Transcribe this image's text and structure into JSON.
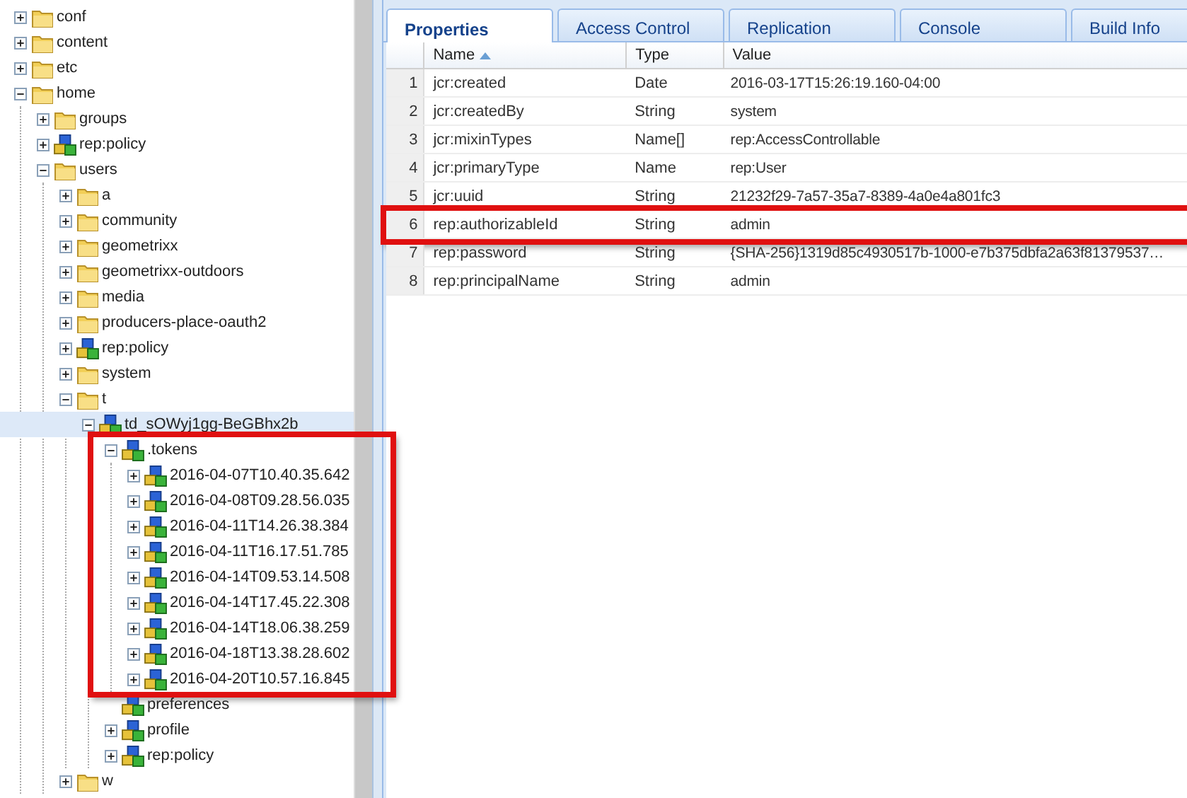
{
  "tree": [
    {
      "label": "conf",
      "kind": "folder",
      "expanded": false,
      "expandable": true,
      "selected": false,
      "highlighted": false
    },
    {
      "label": "content",
      "kind": "folder",
      "expanded": false,
      "expandable": true,
      "selected": false,
      "highlighted": false
    },
    {
      "label": "etc",
      "kind": "folder",
      "expanded": false,
      "expandable": true,
      "selected": false,
      "highlighted": false
    },
    {
      "label": "home",
      "kind": "folder",
      "expanded": true,
      "expandable": true,
      "selected": false,
      "highlighted": false,
      "children": [
        {
          "label": "groups",
          "kind": "folder",
          "expanded": false,
          "expandable": true,
          "selected": false,
          "highlighted": false
        },
        {
          "label": "rep:policy",
          "kind": "node",
          "expanded": false,
          "expandable": true,
          "selected": false,
          "highlighted": false
        },
        {
          "label": "users",
          "kind": "folder",
          "expanded": true,
          "expandable": true,
          "selected": false,
          "highlighted": false,
          "children": [
            {
              "label": "a",
              "kind": "folder",
              "expanded": false,
              "expandable": true,
              "selected": false,
              "highlighted": false
            },
            {
              "label": "community",
              "kind": "folder",
              "expanded": false,
              "expandable": true,
              "selected": false,
              "highlighted": false
            },
            {
              "label": "geometrixx",
              "kind": "folder",
              "expanded": false,
              "expandable": true,
              "selected": false,
              "highlighted": false
            },
            {
              "label": "geometrixx-outdoors",
              "kind": "folder",
              "expanded": false,
              "expandable": true,
              "selected": false,
              "highlighted": false
            },
            {
              "label": "media",
              "kind": "folder",
              "expanded": false,
              "expandable": true,
              "selected": false,
              "highlighted": false
            },
            {
              "label": "producers-place-oauth2",
              "kind": "folder",
              "expanded": false,
              "expandable": true,
              "selected": false,
              "highlighted": false
            },
            {
              "label": "rep:policy",
              "kind": "node",
              "expanded": false,
              "expandable": true,
              "selected": false,
              "highlighted": false
            },
            {
              "label": "system",
              "kind": "folder",
              "expanded": false,
              "expandable": true,
              "selected": false,
              "highlighted": false
            },
            {
              "label": "t",
              "kind": "folder",
              "expanded": true,
              "expandable": true,
              "selected": false,
              "highlighted": false,
              "children": [
                {
                  "label": "td_sOWyj1gg-BeGBhx2b",
                  "kind": "node",
                  "expanded": true,
                  "expandable": true,
                  "selected": true,
                  "highlighted": false,
                  "children": [
                    {
                      "label": ".tokens",
                      "kind": "node",
                      "expanded": true,
                      "expandable": true,
                      "selected": false,
                      "highlighted": true,
                      "children": [
                        {
                          "label": "2016-04-07T10.40.35.642",
                          "kind": "node",
                          "expanded": false,
                          "expandable": true,
                          "selected": false,
                          "highlighted": false
                        },
                        {
                          "label": "2016-04-08T09.28.56.035",
                          "kind": "node",
                          "expanded": false,
                          "expandable": true,
                          "selected": false,
                          "highlighted": false
                        },
                        {
                          "label": "2016-04-11T14.26.38.384",
                          "kind": "node",
                          "expanded": false,
                          "expandable": true,
                          "selected": false,
                          "highlighted": false
                        },
                        {
                          "label": "2016-04-11T16.17.51.785",
                          "kind": "node",
                          "expanded": false,
                          "expandable": true,
                          "selected": false,
                          "highlighted": false
                        },
                        {
                          "label": "2016-04-14T09.53.14.508",
                          "kind": "node",
                          "expanded": false,
                          "expandable": true,
                          "selected": false,
                          "highlighted": false
                        },
                        {
                          "label": "2016-04-14T17.45.22.308",
                          "kind": "node",
                          "expanded": false,
                          "expandable": true,
                          "selected": false,
                          "highlighted": false
                        },
                        {
                          "label": "2016-04-14T18.06.38.259",
                          "kind": "node",
                          "expanded": false,
                          "expandable": true,
                          "selected": false,
                          "highlighted": false
                        },
                        {
                          "label": "2016-04-18T13.38.28.602",
                          "kind": "node",
                          "expanded": false,
                          "expandable": true,
                          "selected": false,
                          "highlighted": false
                        },
                        {
                          "label": "2016-04-20T10.57.16.845",
                          "kind": "node",
                          "expanded": false,
                          "expandable": true,
                          "selected": false,
                          "highlighted": false
                        }
                      ]
                    },
                    {
                      "label": "preferences",
                      "kind": "node",
                      "expanded": false,
                      "expandable": false,
                      "selected": false,
                      "highlighted": false
                    },
                    {
                      "label": "profile",
                      "kind": "node",
                      "expanded": false,
                      "expandable": true,
                      "selected": false,
                      "highlighted": false
                    },
                    {
                      "label": "rep:policy",
                      "kind": "node",
                      "expanded": false,
                      "expandable": true,
                      "selected": false,
                      "highlighted": false
                    }
                  ]
                }
              ]
            },
            {
              "label": "w",
              "kind": "folder",
              "expanded": false,
              "expandable": true,
              "selected": false,
              "highlighted": false
            }
          ]
        }
      ]
    }
  ],
  "tabs": [
    {
      "label": "Properties",
      "selected": true
    },
    {
      "label": "Access Control",
      "selected": false
    },
    {
      "label": "Replication",
      "selected": false
    },
    {
      "label": "Console",
      "selected": false
    },
    {
      "label": "Build Info",
      "selected": false
    }
  ],
  "table": {
    "columns": [
      "Name",
      "Type",
      "Value"
    ],
    "rows": [
      {
        "index": "1",
        "name": "jcr:created",
        "type": "Date",
        "value": "2016-03-17T15:26:19.160-04:00",
        "highlighted": false
      },
      {
        "index": "2",
        "name": "jcr:createdBy",
        "type": "String",
        "value": "system",
        "highlighted": false
      },
      {
        "index": "3",
        "name": "jcr:mixinTypes",
        "type": "Name[]",
        "value": "rep:AccessControllable",
        "highlighted": false
      },
      {
        "index": "4",
        "name": "jcr:primaryType",
        "type": "Name",
        "value": "rep:User",
        "highlighted": false
      },
      {
        "index": "5",
        "name": "jcr:uuid",
        "type": "String",
        "value": "21232f29-7a57-35a7-8389-4a0e4a801fc3",
        "highlighted": false
      },
      {
        "index": "6",
        "name": "rep:authorizableId",
        "type": "String",
        "value": "admin",
        "highlighted": true
      },
      {
        "index": "7",
        "name": "rep:password",
        "type": "String",
        "value": "{SHA-256}1319d85c4930517b-1000-e7b375dbfa2a63f81379537…",
        "highlighted": false
      },
      {
        "index": "8",
        "name": "rep:principalName",
        "type": "String",
        "value": "admin",
        "highlighted": false
      }
    ]
  }
}
